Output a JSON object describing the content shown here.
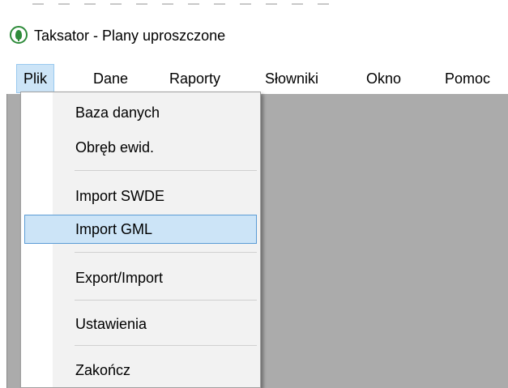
{
  "window": {
    "title": "Taksator - Plany uproszczone",
    "icon": "tree-logo-icon"
  },
  "menubar": {
    "items": [
      {
        "label": "Plik",
        "active": true
      },
      {
        "label": "Dane"
      },
      {
        "label": "Raporty"
      },
      {
        "label": "Słowniki"
      },
      {
        "label": "Okno"
      },
      {
        "label": "Pomoc"
      }
    ]
  },
  "file_menu": {
    "items": [
      {
        "label": "Baza danych"
      },
      {
        "label": "Obręb ewid."
      },
      {
        "label": "Import SWDE"
      },
      {
        "label": "Import GML",
        "highlighted": true
      },
      {
        "label": "Export/Import"
      },
      {
        "label": "Ustawienia"
      },
      {
        "label": "Zakończ"
      }
    ]
  },
  "colors": {
    "highlight_bg": "#cce4f7",
    "highlight_border": "#5b9bd5",
    "workspace_bg": "#ababab",
    "logo_green": "#2e8b3a"
  }
}
